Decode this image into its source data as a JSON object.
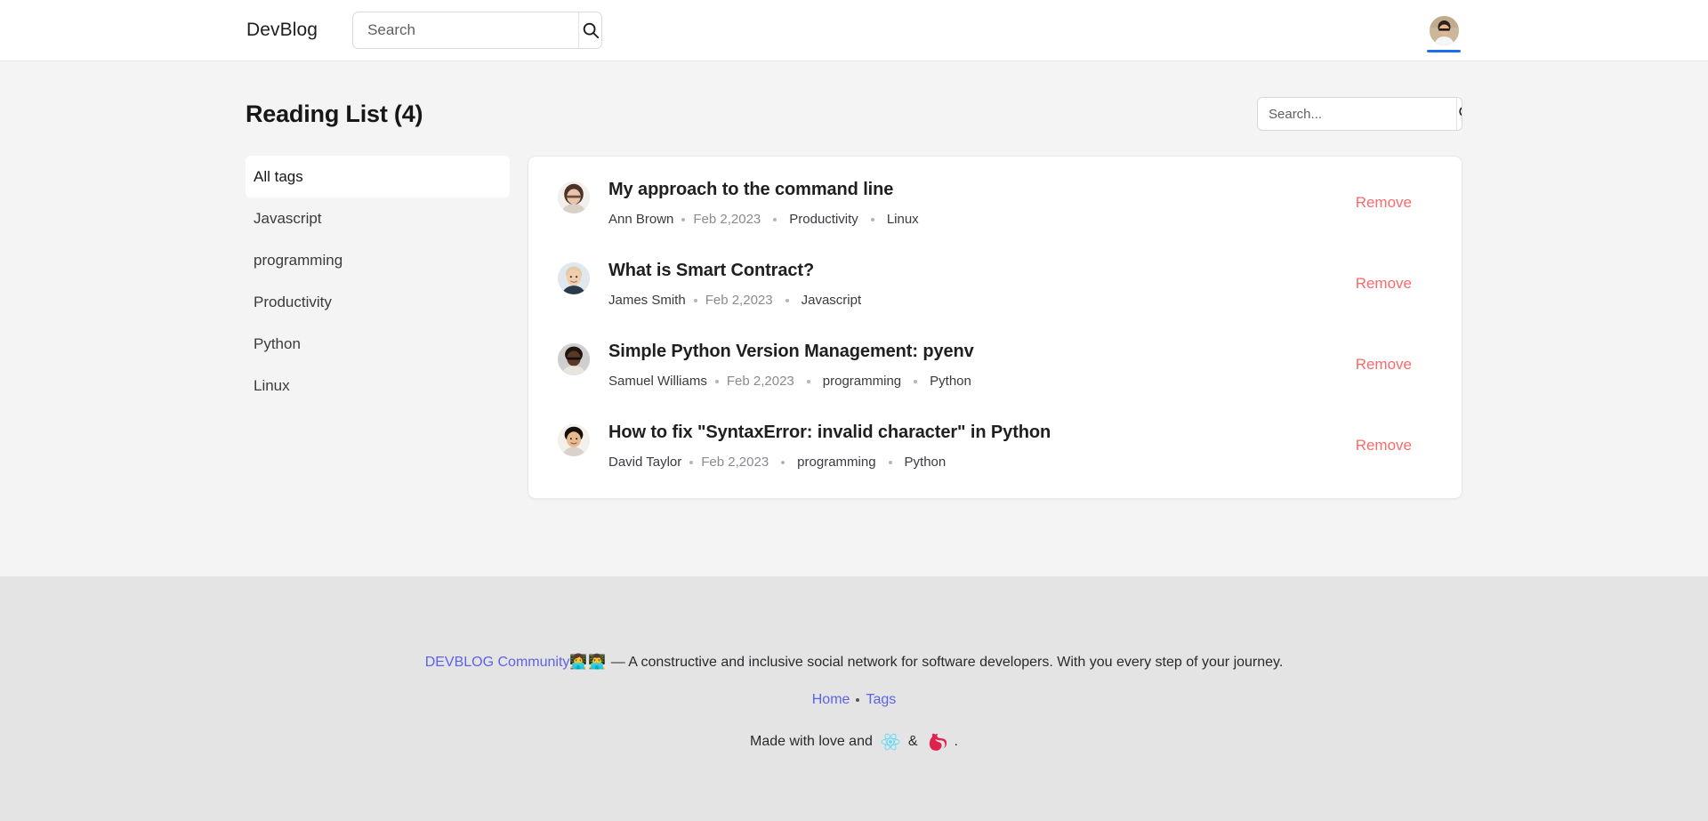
{
  "header": {
    "brand": "DevBlog",
    "search": {
      "value": "",
      "placeholder": "Search"
    },
    "search_icon": "search-icon",
    "avatar_alt": "user-avatar"
  },
  "main": {
    "page_title": "Reading List (4)",
    "list_search": {
      "value": "",
      "placeholder": "Search..."
    },
    "list_search_icon": "search-icon",
    "tags": [
      {
        "label": "All tags",
        "active": true
      },
      {
        "label": "Javascript",
        "active": false
      },
      {
        "label": "programming",
        "active": false
      },
      {
        "label": "Productivity",
        "active": false
      },
      {
        "label": "Python",
        "active": false
      },
      {
        "label": "Linux",
        "active": false
      }
    ],
    "remove_label": "Remove",
    "articles": [
      {
        "title": "My approach to the command line",
        "author": "Ann Brown",
        "date": "Feb 2,2023",
        "tags": [
          "Productivity",
          "Linux"
        ]
      },
      {
        "title": "What is Smart Contract?",
        "author": "James Smith",
        "date": "Feb 2,2023",
        "tags": [
          "Javascript"
        ]
      },
      {
        "title": "Simple Python Version Management: pyenv",
        "author": "Samuel Williams",
        "date": "Feb 2,2023",
        "tags": [
          "programming",
          "Python"
        ]
      },
      {
        "title": "How to fix \"SyntaxError: invalid character\" in Python",
        "author": "David Taylor",
        "date": "Feb 2,2023",
        "tags": [
          "programming",
          "Python"
        ]
      }
    ]
  },
  "footer": {
    "community_link": "DEVBLOG Community",
    "community_emoji": "👩‍💻👨‍💻",
    "tagline": "— A constructive and inclusive social network for software developers. With you every step of your journey.",
    "nav": [
      {
        "label": "Home"
      },
      {
        "label": "Tags"
      }
    ],
    "made_prefix": "Made with love and",
    "made_amp": "&",
    "made_suffix": ".",
    "react_icon": "react-logo-icon",
    "nest_icon": "nestjs-logo-icon"
  },
  "colors": {
    "accent_blue": "#1b6ef3",
    "link_blue": "#5c63e8",
    "remove_red": "#fb6a6a",
    "page_bg": "#f4f4f4",
    "footer_bg": "#e4e4e4",
    "card_bg": "#ffffff"
  }
}
